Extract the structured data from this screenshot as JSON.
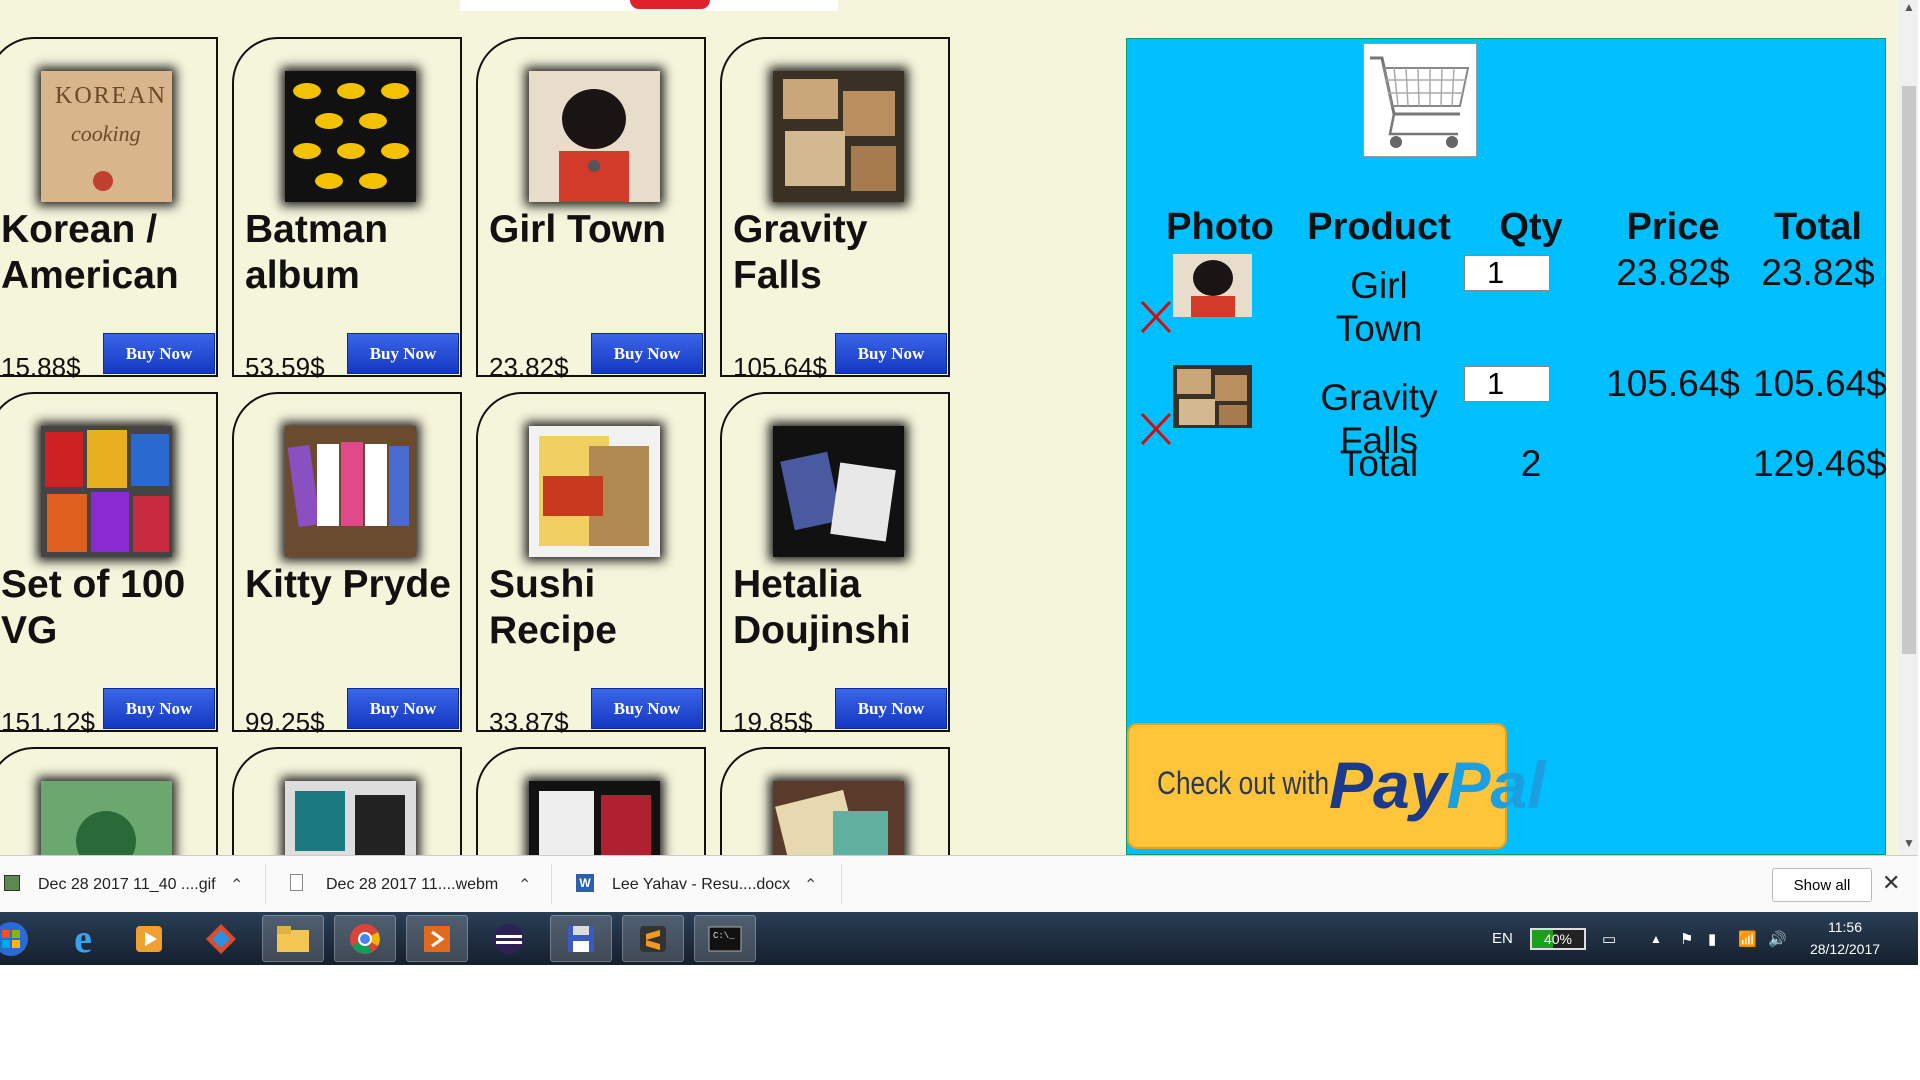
{
  "products": [
    {
      "name": "Korean / American",
      "price": "15.88$",
      "buy_label": "Buy Now"
    },
    {
      "name": "Batman album",
      "price": "53.59$",
      "buy_label": "Buy Now"
    },
    {
      "name": "Girl Town",
      "price": "23.82$",
      "buy_label": "Buy Now"
    },
    {
      "name": "Gravity Falls",
      "price": "105.64$",
      "buy_label": "Buy Now"
    },
    {
      "name": "Set of 100 VG",
      "price": "151.12$",
      "buy_label": "Buy Now"
    },
    {
      "name": "Kitty Pryde",
      "price": "99.25$",
      "buy_label": "Buy Now"
    },
    {
      "name": "Sushi Recipe",
      "price": "33.87$",
      "buy_label": "Buy Now"
    },
    {
      "name": "Hetalia Doujinshi",
      "price": "19.85$",
      "buy_label": "Buy Now"
    }
  ],
  "cart": {
    "headers": {
      "photo": "Photo",
      "product": "Product",
      "qty": "Qty",
      "price": "Price",
      "total": "Total"
    },
    "rows": [
      {
        "product": "Girl Town",
        "qty": "1",
        "price": "23.82$",
        "total": "23.82$"
      },
      {
        "product": "Gravity Falls",
        "qty": "1",
        "price": "105.64$",
        "total": "105.64$"
      }
    ],
    "summary": {
      "label": "Total",
      "qty": "2",
      "total": "129.46$"
    },
    "paypal": {
      "text": "Check out with",
      "pay": "Pay",
      "pal": "Pal"
    }
  },
  "downloads": {
    "items": [
      {
        "name": "Dec 28 2017 11_40 ....gif"
      },
      {
        "name": "Dec 28 2017 11....webm"
      },
      {
        "name": "Lee Yahav - Resu....docx"
      }
    ],
    "show_all": "Show all"
  },
  "taskbar": {
    "language": "EN",
    "battery": "40%",
    "time": "11:56",
    "date": "28/12/2017"
  },
  "colors": {
    "page_bg": "#f5f5dc",
    "cart_bg": "#00bfff",
    "buy_button": "#1f47d6",
    "remove_x": "#d01010",
    "paypal_bg": "#ffc43a"
  }
}
